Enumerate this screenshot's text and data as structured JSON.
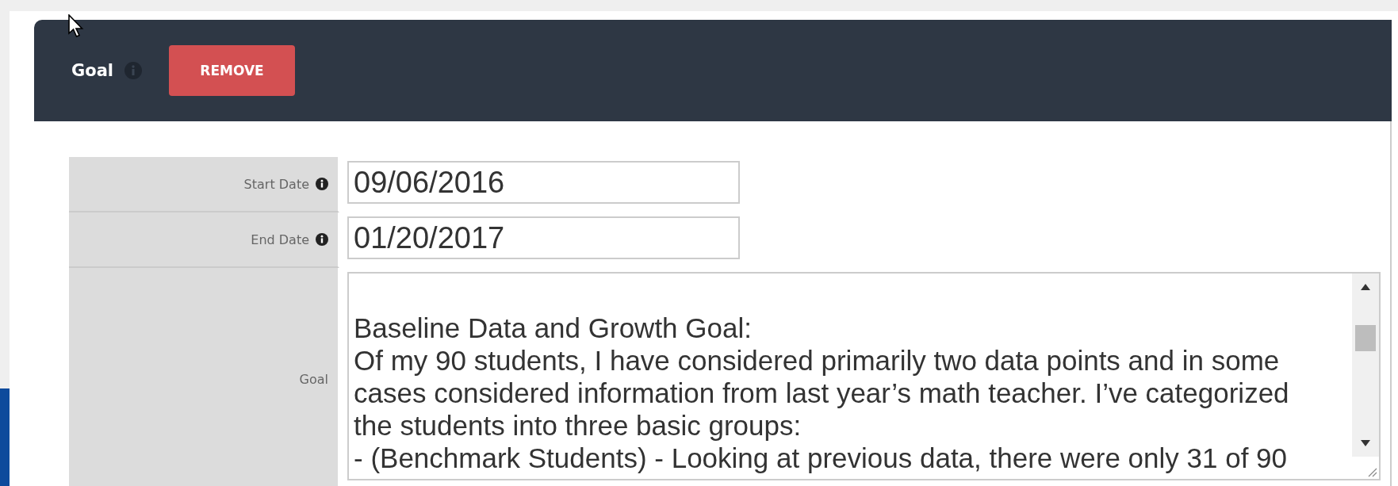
{
  "header": {
    "title": "Goal",
    "remove_button": "REMOVE"
  },
  "fields": [
    {
      "kind": "input",
      "label": "Start Date",
      "info": true,
      "value": "09/06/2016"
    },
    {
      "kind": "input",
      "label": "End Date",
      "info": true,
      "value": "01/20/2017"
    },
    {
      "kind": "textarea",
      "label": "Goal",
      "info": false,
      "paragraphs": [
        [
          "Baseline Data and Growth Goal:",
          "Of my 90 students, I have considered primarily two data points and in some",
          "cases considered information from last year’s math teacher.  I’ve categorized",
          "the students into three basic groups:",
          "- (Benchmark Students) - Looking at previous data, there were only 31 of 90"
        ]
      ]
    }
  ]
}
